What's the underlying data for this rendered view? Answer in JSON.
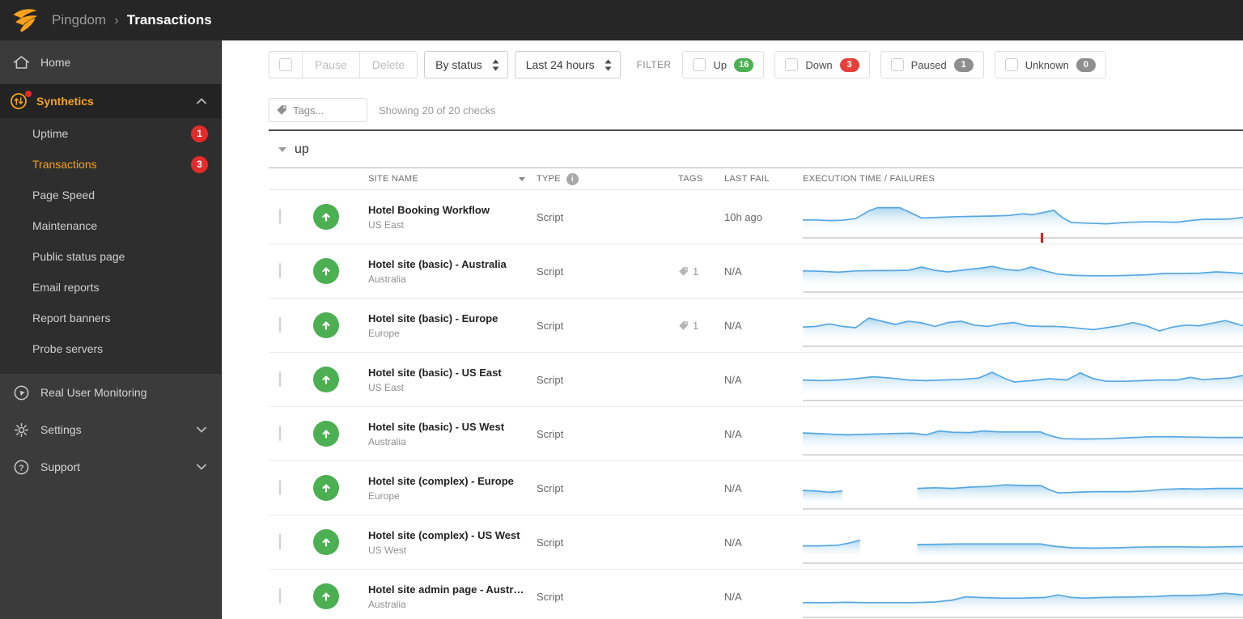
{
  "topbar": {
    "brand": "Pingdom",
    "separator": "›",
    "page": "Transactions"
  },
  "sidebar": {
    "home": "Home",
    "synthetics": "Synthetics",
    "submenu": [
      {
        "label": "Uptime",
        "badge": "1"
      },
      {
        "label": "Transactions",
        "badge": "3"
      },
      {
        "label": "Page Speed",
        "badge": ""
      },
      {
        "label": "Maintenance",
        "badge": ""
      },
      {
        "label": "Public status page",
        "badge": ""
      },
      {
        "label": "Email reports",
        "badge": ""
      },
      {
        "label": "Report banners",
        "badge": ""
      },
      {
        "label": "Probe servers",
        "badge": ""
      }
    ],
    "rum": "Real User Monitoring",
    "settings": "Settings",
    "support": "Support"
  },
  "toolbar": {
    "pause": "Pause",
    "delete": "Delete",
    "status_select": "By status",
    "time_select": "Last 24 hours",
    "filter_label": "FILTER",
    "filters": [
      {
        "label": "Up",
        "count": "16",
        "color": "#4caf52"
      },
      {
        "label": "Down",
        "count": "3",
        "color": "#e6403d"
      },
      {
        "label": "Paused",
        "count": "1",
        "color": "#8f8f8f"
      },
      {
        "label": "Unknown",
        "count": "0",
        "color": "#8f8f8f"
      }
    ]
  },
  "tagsbar": {
    "placeholder": "Tags...",
    "summary": "Showing 20 of 20 checks"
  },
  "group": {
    "label": "up"
  },
  "table": {
    "headers": {
      "site": "SITE NAME",
      "type": "TYPE",
      "tags": "TAGS",
      "last_fail": "LAST FAIL",
      "exec": "EXECUTION TIME / FAILURES"
    }
  },
  "rows": [
    {
      "name": "Hotel Booking Workflow",
      "region": "US East",
      "type": "Script",
      "tags": "",
      "last_fail": "10h ago",
      "chart": {
        "fail_tick": 54,
        "segments": [
          [
            [
              0,
              38
            ],
            [
              3,
              38
            ],
            [
              6,
              36
            ],
            [
              9,
              37
            ],
            [
              12,
              42
            ],
            [
              15,
              66
            ],
            [
              17,
              76
            ],
            [
              22,
              76
            ],
            [
              25,
              57
            ],
            [
              27,
              44
            ],
            [
              31,
              46
            ],
            [
              35,
              48
            ],
            [
              39,
              49
            ],
            [
              43,
              50
            ],
            [
              47,
              52
            ],
            [
              50,
              57
            ],
            [
              52,
              54
            ],
            [
              55,
              62
            ],
            [
              57,
              68
            ],
            [
              59,
              45
            ],
            [
              61,
              30
            ],
            [
              65,
              28
            ],
            [
              69,
              26
            ],
            [
              73,
              30
            ],
            [
              77,
              32
            ],
            [
              81,
              32
            ],
            [
              85,
              31
            ],
            [
              88,
              36
            ],
            [
              91,
              40
            ],
            [
              94,
              40
            ],
            [
              97,
              41
            ],
            [
              100,
              46
            ]
          ]
        ]
      }
    },
    {
      "name": "Hotel site (basic) - Australia",
      "region": "Australia",
      "type": "Script",
      "tags": "1",
      "last_fail": "N/A",
      "chart": {
        "fail_tick": null,
        "segments": [
          [
            [
              0,
              48
            ],
            [
              4,
              47
            ],
            [
              8,
              44
            ],
            [
              12,
              48
            ],
            [
              16,
              49
            ],
            [
              20,
              49
            ],
            [
              24,
              50
            ],
            [
              27,
              60
            ],
            [
              30,
              50
            ],
            [
              33,
              45
            ],
            [
              36,
              50
            ],
            [
              40,
              56
            ],
            [
              43,
              62
            ],
            [
              46,
              53
            ],
            [
              49,
              49
            ],
            [
              52,
              60
            ],
            [
              55,
              48
            ],
            [
              58,
              38
            ],
            [
              62,
              34
            ],
            [
              66,
              33
            ],
            [
              70,
              33
            ],
            [
              74,
              34
            ],
            [
              78,
              36
            ],
            [
              82,
              40
            ],
            [
              86,
              40
            ],
            [
              90,
              41
            ],
            [
              94,
              45
            ],
            [
              97,
              43
            ],
            [
              100,
              40
            ]
          ]
        ]
      }
    },
    {
      "name": "Hotel site (basic) - Europe",
      "region": "Europe",
      "type": "Script",
      "tags": "1",
      "last_fail": "N/A",
      "chart": {
        "fail_tick": null,
        "segments": [
          [
            [
              0,
              42
            ],
            [
              3,
              44
            ],
            [
              6,
              52
            ],
            [
              9,
              44
            ],
            [
              12,
              40
            ],
            [
              15,
              70
            ],
            [
              18,
              60
            ],
            [
              21,
              50
            ],
            [
              24,
              60
            ],
            [
              27,
              55
            ],
            [
              30,
              44
            ],
            [
              33,
              56
            ],
            [
              36,
              60
            ],
            [
              39,
              48
            ],
            [
              42,
              44
            ],
            [
              45,
              52
            ],
            [
              48,
              56
            ],
            [
              51,
              46
            ],
            [
              54,
              44
            ],
            [
              57,
              44
            ],
            [
              60,
              42
            ],
            [
              63,
              38
            ],
            [
              66,
              34
            ],
            [
              69,
              40
            ],
            [
              72,
              46
            ],
            [
              75,
              56
            ],
            [
              78,
              46
            ],
            [
              81,
              30
            ],
            [
              84,
              42
            ],
            [
              87,
              48
            ],
            [
              90,
              46
            ],
            [
              93,
              54
            ],
            [
              96,
              62
            ],
            [
              100,
              46
            ]
          ]
        ]
      }
    },
    {
      "name": "Hotel site (basic) - US East",
      "region": "US East",
      "type": "Script",
      "tags": "",
      "last_fail": "N/A",
      "chart": {
        "fail_tick": null,
        "segments": [
          [
            [
              0,
              46
            ],
            [
              4,
              44
            ],
            [
              8,
              46
            ],
            [
              12,
              50
            ],
            [
              16,
              56
            ],
            [
              20,
              52
            ],
            [
              24,
              46
            ],
            [
              28,
              44
            ],
            [
              32,
              46
            ],
            [
              36,
              48
            ],
            [
              40,
              52
            ],
            [
              43,
              70
            ],
            [
              46,
              50
            ],
            [
              48,
              40
            ],
            [
              52,
              44
            ],
            [
              56,
              50
            ],
            [
              60,
              46
            ],
            [
              63,
              68
            ],
            [
              66,
              50
            ],
            [
              69,
              42
            ],
            [
              73,
              42
            ],
            [
              77,
              44
            ],
            [
              81,
              46
            ],
            [
              85,
              46
            ],
            [
              88,
              54
            ],
            [
              91,
              47
            ],
            [
              94,
              50
            ],
            [
              97,
              52
            ],
            [
              100,
              60
            ]
          ]
        ]
      }
    },
    {
      "name": "Hotel site (basic) - US West",
      "region": "Australia",
      "type": "Script",
      "tags": "",
      "last_fail": "N/A",
      "chart": {
        "fail_tick": null,
        "segments": [
          [
            [
              0,
              50
            ],
            [
              5,
              47
            ],
            [
              10,
              44
            ],
            [
              15,
              46
            ],
            [
              20,
              48
            ],
            [
              25,
              49
            ],
            [
              28,
              44
            ],
            [
              31,
              56
            ],
            [
              34,
              52
            ],
            [
              38,
              51
            ],
            [
              41,
              56
            ],
            [
              45,
              53
            ],
            [
              50,
              53
            ],
            [
              54,
              53
            ],
            [
              56,
              42
            ],
            [
              59,
              32
            ],
            [
              64,
              31
            ],
            [
              69,
              32
            ],
            [
              74,
              35
            ],
            [
              79,
              38
            ],
            [
              84,
              38
            ],
            [
              89,
              37
            ],
            [
              94,
              36
            ],
            [
              100,
              36
            ]
          ]
        ]
      }
    },
    {
      "name": "Hotel site (complex) - Europe",
      "region": "Europe",
      "type": "Script",
      "tags": "",
      "last_fail": "N/A",
      "chart": {
        "fail_tick": null,
        "segments": [
          [
            [
              0,
              40
            ],
            [
              3,
              38
            ],
            [
              6,
              34
            ],
            [
              9,
              38
            ]
          ],
          [
            [
              26,
              46
            ],
            [
              30,
              48
            ],
            [
              34,
              46
            ],
            [
              38,
              50
            ],
            [
              42,
              52
            ],
            [
              46,
              57
            ],
            [
              50,
              55
            ],
            [
              54,
              55
            ],
            [
              56,
              42
            ],
            [
              58,
              32
            ],
            [
              62,
              34
            ],
            [
              66,
              36
            ],
            [
              70,
              36
            ],
            [
              74,
              36
            ],
            [
              78,
              38
            ],
            [
              82,
              43
            ],
            [
              86,
              45
            ],
            [
              90,
              44
            ],
            [
              94,
              46
            ],
            [
              100,
              46
            ]
          ]
        ]
      }
    },
    {
      "name": "Hotel site (complex) - US West",
      "region": "US West",
      "type": "Script",
      "tags": "",
      "last_fail": "N/A",
      "chart": {
        "fail_tick": null,
        "segments": [
          [
            [
              0,
              36
            ],
            [
              4,
              36
            ],
            [
              8,
              38
            ],
            [
              11,
              46
            ],
            [
              13,
              54
            ]
          ],
          [
            [
              26,
              40
            ],
            [
              31,
              41
            ],
            [
              36,
              42
            ],
            [
              41,
              42
            ],
            [
              46,
              42
            ],
            [
              51,
              42
            ],
            [
              54,
              42
            ],
            [
              57,
              35
            ],
            [
              61,
              30
            ],
            [
              66,
              29
            ],
            [
              71,
              30
            ],
            [
              76,
              32
            ],
            [
              81,
              33
            ],
            [
              86,
              33
            ],
            [
              91,
              32
            ],
            [
              96,
              33
            ],
            [
              100,
              34
            ]
          ]
        ]
      }
    },
    {
      "name": "Hotel site admin page - Austr…",
      "region": "Australia",
      "type": "Script",
      "tags": "",
      "last_fail": "N/A",
      "chart": {
        "fail_tick": null,
        "segments": [
          [
            [
              0,
              28
            ],
            [
              5,
              28
            ],
            [
              10,
              29
            ],
            [
              15,
              28
            ],
            [
              20,
              28
            ],
            [
              25,
              28
            ],
            [
              30,
              30
            ],
            [
              34,
              36
            ],
            [
              37,
              46
            ],
            [
              40,
              44
            ],
            [
              45,
              42
            ],
            [
              50,
              42
            ],
            [
              55,
              44
            ],
            [
              58,
              52
            ],
            [
              61,
              44
            ],
            [
              64,
              42
            ],
            [
              68,
              44
            ],
            [
              72,
              45
            ],
            [
              76,
              46
            ],
            [
              80,
              47
            ],
            [
              84,
              50
            ],
            [
              88,
              50
            ],
            [
              92,
              52
            ],
            [
              96,
              57
            ],
            [
              100,
              52
            ]
          ]
        ]
      }
    }
  ],
  "colors": {
    "accent_orange": "#f3a21c",
    "up_green": "#4caf52",
    "down_red": "#e32b2b",
    "spark_stroke": "#57a7e2",
    "spark_fill": "#a8d4ef",
    "topbar_bg": "#262626",
    "sidebar_bg": "#3b3b3b"
  }
}
